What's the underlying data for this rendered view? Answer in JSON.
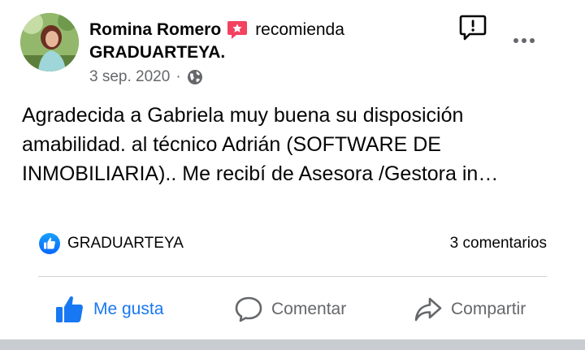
{
  "post": {
    "author": "Romina Romero",
    "recommends_text": "recomienda",
    "page_name": "GRADUARTEYA.",
    "date": "3 sep. 2020",
    "separator": "·",
    "body": "Agradecida a Gabriela muy buena su disposición amabilidad. al técnico Adrián (SOFTWARE DE INMOBILIARIA).. Me recibí de Asesora /Gestora in…"
  },
  "reactions": {
    "liked_by": "GRADUARTEYA",
    "comments": "3 comentarios"
  },
  "actions": {
    "like": "Me gusta",
    "comment": "Comentar",
    "share": "Compartir"
  },
  "colors": {
    "accent": "#1877f2",
    "recommend": "#f3425f",
    "secondary_text": "#65676b",
    "divider": "#ced0d4"
  },
  "icons": {
    "recommend": "recommend-icon",
    "globe": "globe-icon",
    "report": "report-icon",
    "more": "more-icon",
    "like_badge": "like-badge-icon",
    "like": "thumbs-up-icon",
    "comment": "comment-icon",
    "share": "share-icon"
  }
}
